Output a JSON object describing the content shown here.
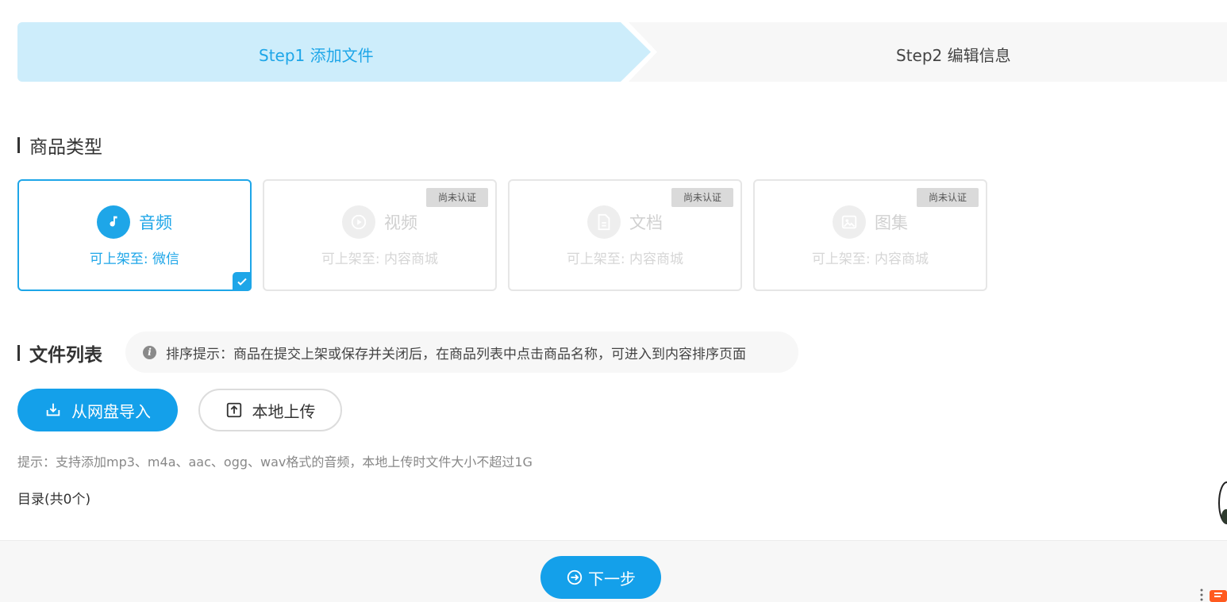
{
  "steps": [
    {
      "label": "Step1 添加文件",
      "active": true
    },
    {
      "label": "Step2 编辑信息",
      "active": false
    }
  ],
  "sections": {
    "type_title": "商品类型",
    "files_title": "文件列表"
  },
  "product_types": [
    {
      "name": "音频",
      "shelf": "可上架至: 微信",
      "selected": true,
      "badge": "",
      "icon": "music-note-icon"
    },
    {
      "name": "视频",
      "shelf": "可上架至: 内容商城",
      "selected": false,
      "badge": "尚未认证",
      "icon": "play-icon"
    },
    {
      "name": "文档",
      "shelf": "可上架至: 内容商城",
      "selected": false,
      "badge": "尚未认证",
      "icon": "document-icon"
    },
    {
      "name": "图集",
      "shelf": "可上架至: 内容商城",
      "selected": false,
      "badge": "尚未认证",
      "icon": "image-icon"
    }
  ],
  "sort_tip": "排序提示：商品在提交上架或保存并关闭后，在商品列表中点击商品名称，可进入到内容排序页面",
  "buttons": {
    "netdisk_import": "从网盘导入",
    "local_upload": "本地上传",
    "next": "下一步"
  },
  "upload_hint": "提示：支持添加mp3、m4a、aac、ogg、wav格式的音频，本地上传时文件大小不超过1G",
  "directory_count": "目录(共0个)",
  "colors": {
    "accent": "#14a0ea",
    "step_active_bg": "#cdedfb",
    "step_inactive_bg": "#f7f7f7"
  }
}
